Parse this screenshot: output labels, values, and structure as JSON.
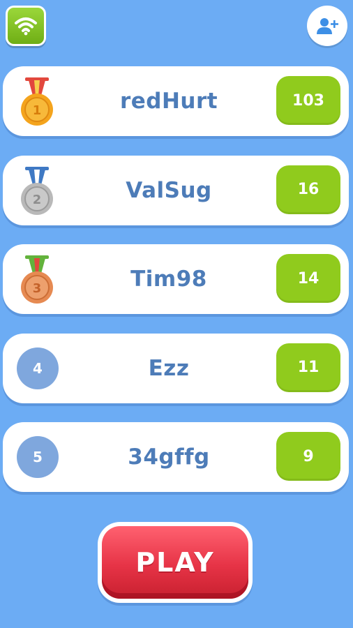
{
  "top_bar": {
    "left_icon": "wifi-icon",
    "right_icon": "add-friend-icon"
  },
  "leaderboard": [
    {
      "rank": "1",
      "name": "redHurt",
      "score": "103",
      "badge": "gold-medal",
      "medal_color": "#f4a41d",
      "ribbon_color": "#e2483d"
    },
    {
      "rank": "2",
      "name": "ValSug",
      "score": "16",
      "badge": "silver-medal",
      "medal_color": "#b9b9b9",
      "ribbon_color": "#3f79c4"
    },
    {
      "rank": "3",
      "name": "Tim98",
      "score": "14",
      "badge": "bronze-medal",
      "medal_color": "#e68a52",
      "ribbon_color": "#63b33c"
    },
    {
      "rank": "4",
      "name": "Ezz",
      "score": "11",
      "badge": "rank-circle"
    },
    {
      "rank": "5",
      "name": "34gffg",
      "score": "9",
      "badge": "rank-circle"
    }
  ],
  "play_button": {
    "label": "PLAY"
  },
  "colors": {
    "background": "#6cacf4",
    "score_badge": "#90cb1d",
    "name_text": "#4d7cb8",
    "play_button": "#e63346",
    "rank_circle": "#7fa7dd"
  }
}
